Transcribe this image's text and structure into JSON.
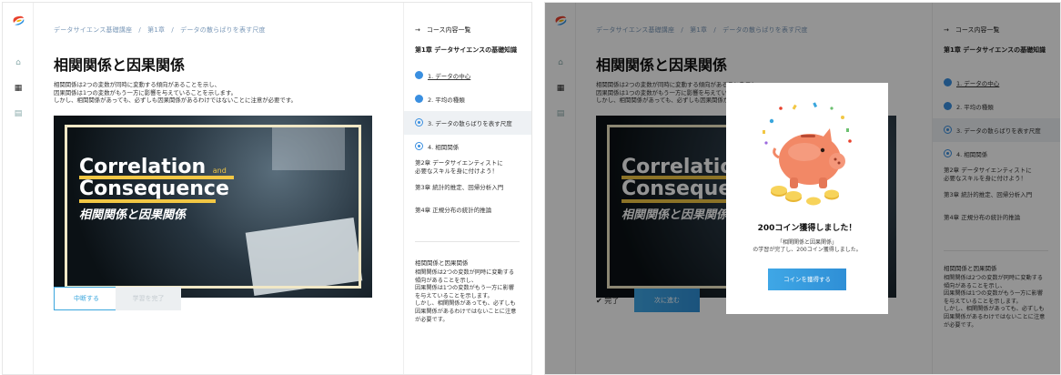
{
  "left": {
    "breadcrumb": "データサイエンス基礎講座　/　第1章　/　データの散らばりを表す尺度",
    "title": "相関関係と因果関係",
    "description": [
      "相関関係は2つの変数が同時に変動する傾向があることを示し、",
      "因果関係は1つの変数がもう一方に影響を与えていることを示します。",
      "しかし、相関関係があっても、必ずしも因果関係があるわけではないことに注意が必要です。"
    ],
    "hero": {
      "line1": "Correlation",
      "line1_small": "and",
      "line2": "Consequence",
      "line3": "相関関係と因果関係"
    },
    "buttons": {
      "interrupt": "中断する",
      "complete": "学習を完了"
    }
  },
  "sidebar": {
    "header": "→　コース内容一覧",
    "chapter_title": "第1章 データサイエンスの基礎知識",
    "items": [
      {
        "label": "1. データの中心",
        "status": "done"
      },
      {
        "label": "2. 平均の種類",
        "status": "done"
      },
      {
        "label": "3. データの散らばりを表す尺度",
        "status": "current"
      },
      {
        "label": "4. 相関関係",
        "status": "current"
      }
    ],
    "other_chapters": [
      [
        "第2章 データサイエンティストに",
        "必要なスキルを身に付けよう！"
      ],
      [
        "第3章 統計的推定、回帰分析入門"
      ],
      [
        "第4章 正規分布の統計的推論"
      ]
    ],
    "summary_title": "相関関係と因果関係",
    "summary": [
      "相関関係は2つの変数が同時に変動する",
      "傾向があることを示し、",
      "因果関係は1つの変数がもう一方に影響",
      "を与えていることを示します。",
      "しかし、相関関係があっても、必ずしも",
      "因果関係があるわけではないことに注意",
      "が必要です。"
    ]
  },
  "right": {
    "done_label": "✔ 完了",
    "next_button": "次に進む",
    "modal": {
      "title": "200コイン獲得しました！",
      "text": [
        "「相関関係と因果関係」",
        "の学習が完了し、200コイン獲得しました。"
      ],
      "button": "コインを獲得する"
    }
  },
  "colors": {
    "accent": "#3aa6dd",
    "primary_gradient_start": "#3fa7e6",
    "highlight": "#f2c744"
  }
}
